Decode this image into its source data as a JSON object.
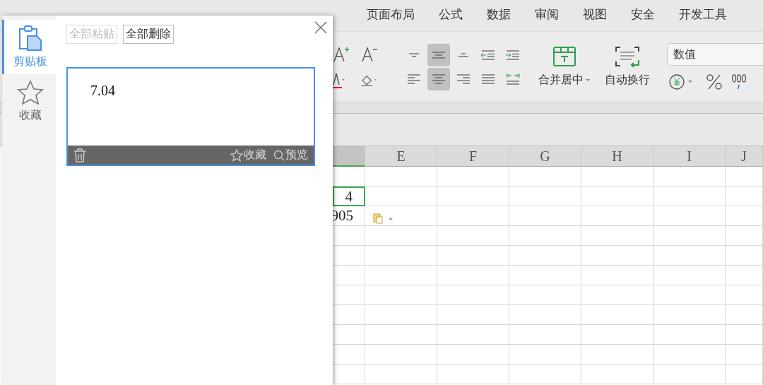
{
  "menu_tabs": [
    {
      "label": "页面布局",
      "selected": false
    },
    {
      "label": "公式",
      "selected": false
    },
    {
      "label": "数据",
      "selected": false
    },
    {
      "label": "审阅",
      "selected": false
    },
    {
      "label": "视图",
      "selected": false
    },
    {
      "label": "安全",
      "selected": false
    },
    {
      "label": "开发工具",
      "selected": false
    }
  ],
  "ribbon": {
    "align_buttons": [
      {
        "kind": "top",
        "selected": false
      },
      {
        "kind": "middle",
        "selected": true
      },
      {
        "kind": "bottom",
        "selected": false
      },
      {
        "kind": "outdent",
        "selected": false
      },
      {
        "kind": "indent",
        "selected": false
      },
      {
        "kind": "left",
        "selected": false
      },
      {
        "kind": "center",
        "selected": true
      },
      {
        "kind": "right",
        "selected": false
      },
      {
        "kind": "justify",
        "selected": false
      },
      {
        "kind": "distribute",
        "selected": false
      }
    ],
    "merge_button": "合并居中",
    "wrap_button": "自动换行",
    "number_format": "数值"
  },
  "sheet": {
    "columns": [
      "E",
      "F",
      "G",
      "H",
      "I",
      "J"
    ],
    "cells": [
      {
        "text": "4",
        "selected": true
      },
      {
        "text": "905",
        "selected": false
      }
    ]
  },
  "clipboard_panel": {
    "nav": [
      {
        "label": "剪贴板",
        "kind": "clipboard",
        "selected": true
      },
      {
        "label": "收藏",
        "kind": "favorites",
        "selected": false
      }
    ],
    "paste_all": {
      "label": "全部粘贴",
      "disabled": true
    },
    "delete_all": {
      "label": "全部删除",
      "disabled": false
    },
    "items": [
      {
        "text": "7.04",
        "favorite_label": "收藏",
        "preview_label": "预览"
      }
    ]
  }
}
